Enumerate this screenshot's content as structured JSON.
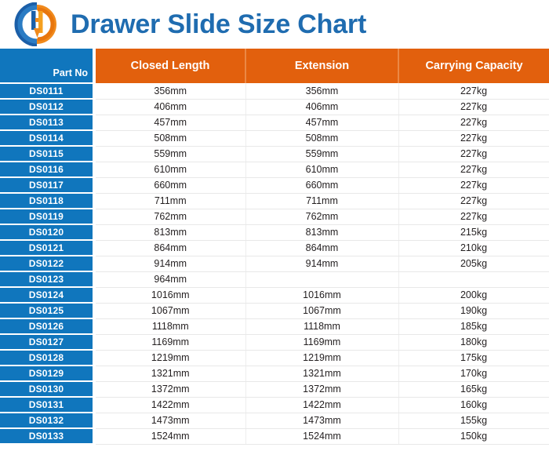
{
  "header": {
    "title": "Drawer Slide Size Chart",
    "logo_name": "company-logo",
    "title_color": "#1f6cb0"
  },
  "colors": {
    "brand_blue": "#1076bd",
    "brand_orange": "#e2600d",
    "title_blue": "#1f6cb0",
    "row_text": "#231f20",
    "row_divider": "#e8e8e8"
  },
  "table": {
    "columns": [
      {
        "key": "part_no",
        "label": "Part No",
        "style": "blue"
      },
      {
        "key": "closed_length",
        "label": "Closed Length",
        "style": "orange"
      },
      {
        "key": "extension",
        "label": "Extension",
        "style": "orange"
      },
      {
        "key": "carrying_capacity",
        "label": "Carrying Capacity",
        "style": "orange"
      }
    ],
    "rows": [
      {
        "part_no": "DS0111",
        "closed_length": "356mm",
        "extension": "356mm",
        "carrying_capacity": "227kg"
      },
      {
        "part_no": "DS0112",
        "closed_length": "406mm",
        "extension": "406mm",
        "carrying_capacity": "227kg"
      },
      {
        "part_no": "DS0113",
        "closed_length": "457mm",
        "extension": "457mm",
        "carrying_capacity": "227kg"
      },
      {
        "part_no": "DS0114",
        "closed_length": "508mm",
        "extension": "508mm",
        "carrying_capacity": "227kg"
      },
      {
        "part_no": "DS0115",
        "closed_length": "559mm",
        "extension": "559mm",
        "carrying_capacity": "227kg"
      },
      {
        "part_no": "DS0116",
        "closed_length": "610mm",
        "extension": "610mm",
        "carrying_capacity": "227kg"
      },
      {
        "part_no": "DS0117",
        "closed_length": "660mm",
        "extension": "660mm",
        "carrying_capacity": "227kg"
      },
      {
        "part_no": "DS0118",
        "closed_length": "711mm",
        "extension": "711mm",
        "carrying_capacity": "227kg"
      },
      {
        "part_no": "DS0119",
        "closed_length": "762mm",
        "extension": "762mm",
        "carrying_capacity": "227kg"
      },
      {
        "part_no": "DS0120",
        "closed_length": "813mm",
        "extension": "813mm",
        "carrying_capacity": "215kg"
      },
      {
        "part_no": "DS0121",
        "closed_length": "864mm",
        "extension": "864mm",
        "carrying_capacity": "210kg"
      },
      {
        "part_no": "DS0122",
        "closed_length": "914mm",
        "extension": "914mm",
        "carrying_capacity": "205kg"
      },
      {
        "part_no": "DS0123",
        "closed_length": "964mm",
        "extension": "",
        "carrying_capacity": ""
      },
      {
        "part_no": "DS0124",
        "closed_length": "1016mm",
        "extension": "1016mm",
        "carrying_capacity": "200kg"
      },
      {
        "part_no": "DS0125",
        "closed_length": "1067mm",
        "extension": "1067mm",
        "carrying_capacity": "190kg"
      },
      {
        "part_no": "DS0126",
        "closed_length": "1118mm",
        "extension": "1118mm",
        "carrying_capacity": "185kg"
      },
      {
        "part_no": "DS0127",
        "closed_length": "1169mm",
        "extension": "1169mm",
        "carrying_capacity": "180kg"
      },
      {
        "part_no": "DS0128",
        "closed_length": "1219mm",
        "extension": "1219mm",
        "carrying_capacity": "175kg"
      },
      {
        "part_no": "DS0129",
        "closed_length": "1321mm",
        "extension": "1321mm",
        "carrying_capacity": "170kg"
      },
      {
        "part_no": "DS0130",
        "closed_length": "1372mm",
        "extension": "1372mm",
        "carrying_capacity": "165kg"
      },
      {
        "part_no": "DS0131",
        "closed_length": "1422mm",
        "extension": "1422mm",
        "carrying_capacity": "160kg"
      },
      {
        "part_no": "DS0132",
        "closed_length": "1473mm",
        "extension": "1473mm",
        "carrying_capacity": "155kg"
      },
      {
        "part_no": "DS0133",
        "closed_length": "1524mm",
        "extension": "1524mm",
        "carrying_capacity": "150kg"
      }
    ]
  }
}
